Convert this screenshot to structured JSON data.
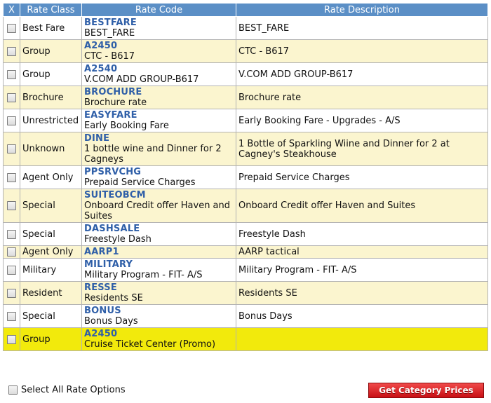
{
  "table": {
    "headers": {
      "x": "X",
      "rate_class": "Rate Class",
      "rate_code": "Rate Code",
      "rate_description": "Rate Description"
    },
    "rows": [
      {
        "rate_class": "Best Fare",
        "code": "BESTFARE",
        "code_desc": "BEST_FARE",
        "description": "BEST_FARE",
        "highlight": false
      },
      {
        "rate_class": "Group",
        "code": "A2450",
        "code_desc": "CTC - B617",
        "description": "CTC - B617",
        "highlight": false
      },
      {
        "rate_class": "Group",
        "code": "A2540",
        "code_desc": "V.COM ADD GROUP-B617",
        "description": "V.COM ADD GROUP-B617",
        "highlight": false
      },
      {
        "rate_class": "Brochure",
        "code": "BROCHURE",
        "code_desc": "Brochure rate",
        "description": "Brochure rate",
        "highlight": false
      },
      {
        "rate_class": "Unrestricted",
        "code": "EASYFARE",
        "code_desc": "Early Booking Fare",
        "description": "Early Booking Fare - Upgrades - A/S",
        "highlight": false
      },
      {
        "rate_class": "Unknown",
        "code": "DINE",
        "code_desc": "1 bottle wine and Dinner for 2 Cagneys",
        "description": "1 Bottle of Sparkling Wiine and Dinner for 2 at Cagney's Steakhouse",
        "highlight": false
      },
      {
        "rate_class": "Agent Only",
        "code": "PPSRVCHG",
        "code_desc": "Prepaid Service Charges",
        "description": "Prepaid Service Charges",
        "highlight": false
      },
      {
        "rate_class": "Special",
        "code": "SUITEOBCM",
        "code_desc": "Onboard Credit offer Haven and Suites",
        "description": "Onboard Credit offer Haven and Suites",
        "highlight": false
      },
      {
        "rate_class": "Special",
        "code": "DASHSALE",
        "code_desc": "Freestyle Dash",
        "description": "Freestyle Dash",
        "highlight": false
      },
      {
        "rate_class": "Agent Only",
        "code": "AARP1",
        "code_desc": "",
        "description": "AARP tactical",
        "highlight": false
      },
      {
        "rate_class": "Military",
        "code": "MILITARY",
        "code_desc": "Military Program - FIT- A/S",
        "description": "Military Program - FIT- A/S",
        "highlight": false
      },
      {
        "rate_class": "Resident",
        "code": "RESSE",
        "code_desc": "Residents SE",
        "description": "Residents SE",
        "highlight": false
      },
      {
        "rate_class": "Special",
        "code": "BONUS",
        "code_desc": "Bonus Days",
        "description": "Bonus Days",
        "highlight": false
      },
      {
        "rate_class": "Group",
        "code": "A2450",
        "code_desc": "Cruise Ticket Center (Promo)",
        "description": "",
        "highlight": true
      }
    ]
  },
  "footer": {
    "select_all_label": "Select All Rate Options",
    "get_prices_label": "Get Category Prices"
  },
  "colors": {
    "header_bg": "#5b8fc6",
    "code_text": "#2f5fa8",
    "alt_row_bg": "#fbf5cf",
    "highlight_row_bg": "#f2ea0c",
    "button_bg": "#d81f24"
  }
}
